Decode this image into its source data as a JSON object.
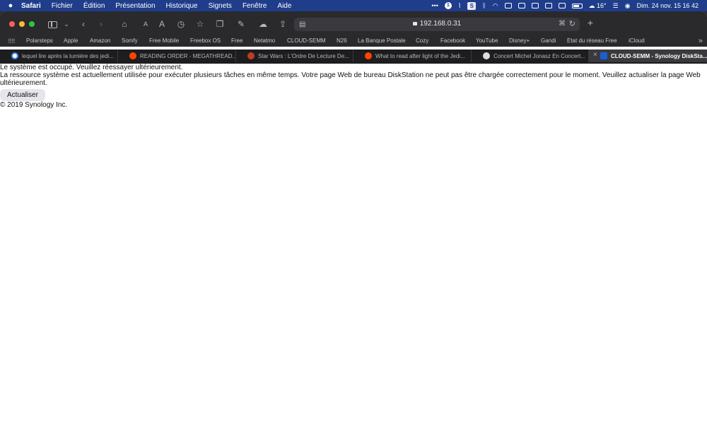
{
  "menubar": {
    "app": "Safari",
    "items": [
      "Fichier",
      "Édition",
      "Présentation",
      "Historique",
      "Signets",
      "Fenêtre",
      "Aide"
    ],
    "status": {
      "dots": "•••",
      "temperature": "16°",
      "datetime": "Dim. 24 nov.  15 16 42"
    }
  },
  "toolbar": {
    "url": "192.168.0.31",
    "font_small": "A",
    "font_large": "A"
  },
  "bookmarks": [
    "Polarsteps",
    "Apple",
    "Amazon",
    "Somfy",
    "Free Mobile",
    "Freebox OS",
    "Free",
    "Netatmo",
    "CLOUD-SEMM",
    "N26",
    "La Banque Postale",
    "Cozy",
    "Facebook",
    "YouTube",
    "Disney+",
    "Gandi",
    "Etat du réseau Free",
    "iCloud"
  ],
  "tabs": [
    {
      "title": "lequel lire après la lumière des jedi...",
      "favicon_color": "#ffffff"
    },
    {
      "title": "READING ORDER - MEGATHREAD...",
      "favicon_color": "#ff4500"
    },
    {
      "title": "Star Wars : L'Ordre De Lecture De...",
      "favicon_color": "#c23b22"
    },
    {
      "title": "What to read after light of the Jedi...",
      "favicon_color": "#ff4500"
    },
    {
      "title": "Concert Michel Jonasz En Concert...",
      "favicon_color": "#dddddd"
    },
    {
      "title": "CLOUD-SEMM - Synology DiskSta...",
      "favicon_color": "#1a5fd6"
    }
  ],
  "page": {
    "line1": "Le système est occupé. Veuillez réessayer ultérieurement.",
    "line2": "La ressource système est actuellement utilisée pour exécuter plusieurs tâches en même temps. Votre page Web de bureau DiskStation ne peut pas être chargée correctement pour le moment. Veuillez actualiser la page Web ultérieurement.",
    "button": "Actualiser",
    "copyright": "© 2019 Synology Inc."
  }
}
